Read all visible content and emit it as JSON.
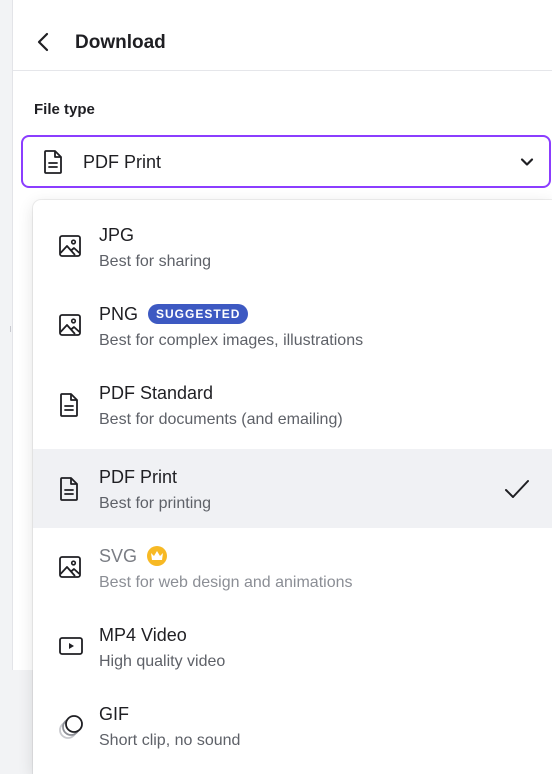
{
  "header": {
    "title": "Download"
  },
  "file_type": {
    "label": "File type",
    "selected_value": "PDF Print"
  },
  "options": [
    {
      "name": "JPG",
      "description": "Best for sharing",
      "icon": "image-icon"
    },
    {
      "name": "PNG",
      "badge": "SUGGESTED",
      "description": "Best for complex images, illustrations",
      "icon": "image-icon"
    },
    {
      "name": "PDF Standard",
      "description": "Best for documents (and emailing)",
      "icon": "document-icon"
    },
    {
      "name": "PDF Print",
      "description": "Best for printing",
      "icon": "document-icon",
      "selected": true
    },
    {
      "name": "SVG",
      "description": "Best for web design and animations",
      "icon": "image-icon",
      "premium": true
    },
    {
      "name": "MP4 Video",
      "description": "High quality video",
      "icon": "video-icon"
    },
    {
      "name": "GIF",
      "description": "Short clip, no sound",
      "icon": "gif-icon"
    }
  ],
  "colors": {
    "accent": "#8b3dff",
    "badge": "#3d59c2",
    "crown": "#f7b924",
    "selected_row": "#f0f1f4"
  }
}
